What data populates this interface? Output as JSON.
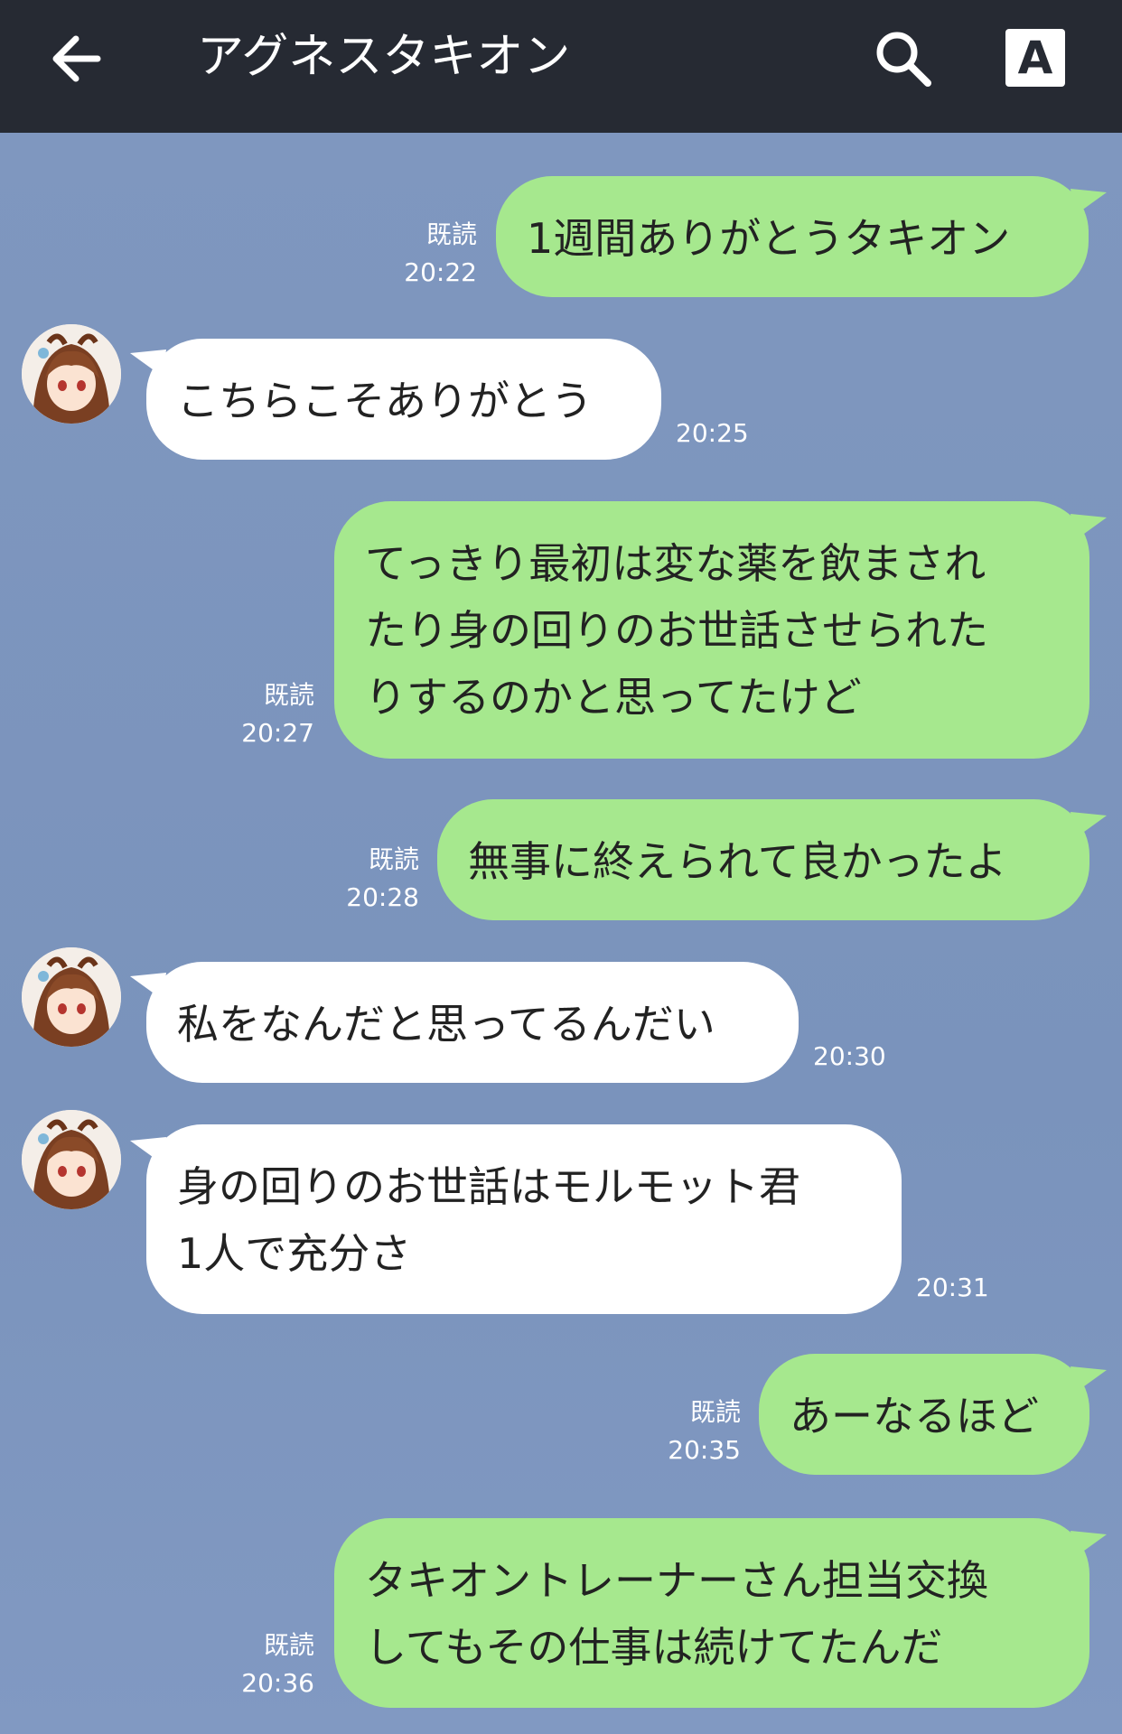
{
  "header": {
    "title": "アグネスタキオン"
  },
  "messages": [
    {
      "dir": "out",
      "lines": [
        "1週間ありがとうタキオン"
      ],
      "read": "既読",
      "time": "20:22"
    },
    {
      "dir": "in",
      "lines": [
        "こちらこそありがとう"
      ],
      "time": "20:25"
    },
    {
      "dir": "out",
      "lines": [
        "てっきり最初は変な薬を飲まされ",
        "たり身の回りのお世話させられた",
        "りするのかと思ってたけど"
      ],
      "read": "既読",
      "time": "20:27"
    },
    {
      "dir": "out",
      "lines": [
        "無事に終えられて良かったよ"
      ],
      "read": "既読",
      "time": "20:28"
    },
    {
      "dir": "in",
      "lines": [
        "私をなんだと思ってるんだい"
      ],
      "time": "20:30"
    },
    {
      "dir": "in",
      "lines": [
        "身の回りのお世話はモルモット君",
        "1人で充分さ"
      ],
      "time": "20:31"
    },
    {
      "dir": "out",
      "lines": [
        "あーなるほど"
      ],
      "read": "既読",
      "time": "20:35"
    },
    {
      "dir": "out",
      "lines": [
        "タキオントレーナーさん担当交換",
        "してもその仕事は続けてたんだ"
      ],
      "read": "既読",
      "time": "20:36"
    }
  ],
  "colors": {
    "header_bg": "#262a33",
    "chat_bg": "#7b94bd",
    "bubble_out": "#a6e88e",
    "bubble_in": "#ffffff"
  },
  "icons": [
    "back-arrow-icon",
    "search-icon",
    "font-size-icon"
  ]
}
